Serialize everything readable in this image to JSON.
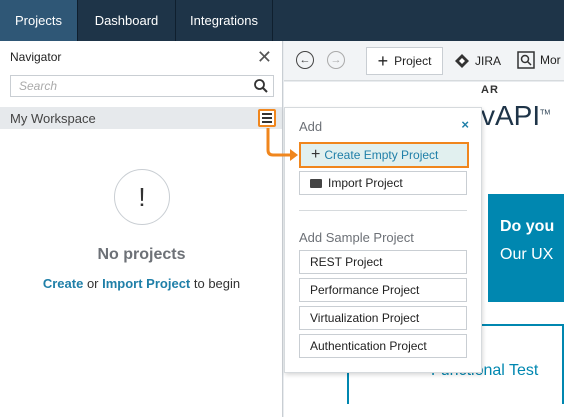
{
  "tabs": [
    {
      "label": "Projects",
      "active": true
    },
    {
      "label": "Dashboard",
      "active": false
    },
    {
      "label": "Integrations",
      "active": false
    }
  ],
  "navigator": {
    "title": "Navigator",
    "search_placeholder": "Search",
    "workspace_label": "My Workspace",
    "empty_title": "No projects",
    "create_link": "Create",
    "or_text": " or ",
    "import_link": "Import Project",
    "begin_text": " to begin"
  },
  "toolbar": {
    "project_label": "Project",
    "jira_label": "JIRA",
    "monitor_label": "Mor"
  },
  "content": {
    "brand_small": "AR",
    "brand_big": "vAPI",
    "brand_tm": "TM",
    "hero_line1": "Do you",
    "hero_line2": "Our UX",
    "functional_test": "Functional Test"
  },
  "dropdown": {
    "title": "Add",
    "close": "×",
    "create_empty": "Create Empty Project",
    "import_project": "Import Project",
    "sample_title": "Add Sample Project",
    "samples": [
      "REST Project",
      "Performance Project",
      "Virtualization Project",
      "Authentication Project"
    ]
  },
  "colors": {
    "topbar": "#1e3448",
    "active_tab": "#2f5776",
    "accent": "#0087b0",
    "highlight": "#f0861d",
    "link": "#1f7fa8"
  }
}
